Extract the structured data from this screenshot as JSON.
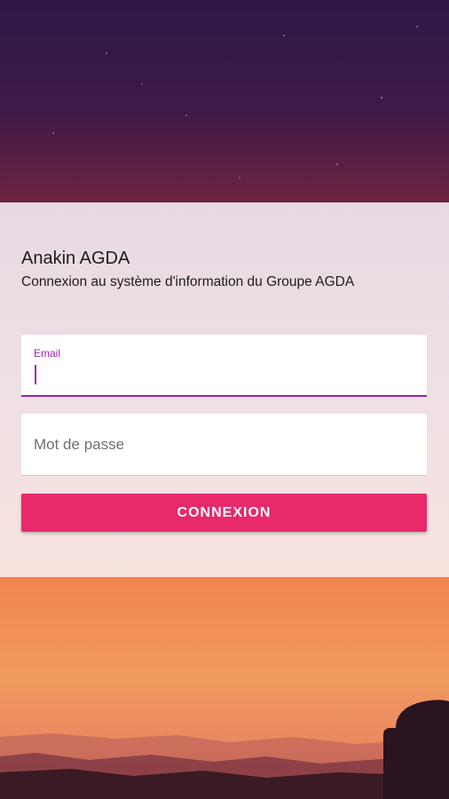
{
  "app": {
    "title": "Anakin AGDA",
    "subtitle": "Connexion au système d'information du Groupe AGDA"
  },
  "form": {
    "email": {
      "label": "Email",
      "value": ""
    },
    "password": {
      "placeholder": "Mot de passe",
      "value": ""
    },
    "submit_label": "CONNEXION"
  },
  "colors": {
    "accent": "#9c27b0",
    "button": "#e8296c",
    "sky_top": "#2e1a4a",
    "sky_bottom_band": "#f08a52"
  }
}
